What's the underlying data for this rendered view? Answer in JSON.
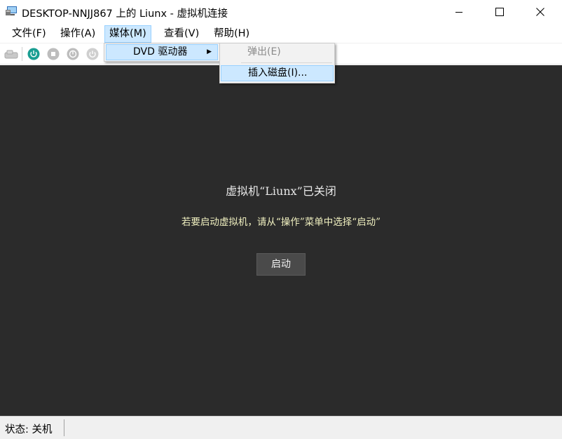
{
  "window": {
    "title": "DESKTOP-NNJJ867 上的 Liunx - 虚拟机连接"
  },
  "menubar": {
    "items": [
      {
        "label": "文件(F)"
      },
      {
        "label": "操作(A)"
      },
      {
        "label": "媒体(M)"
      },
      {
        "label": "查看(V)"
      },
      {
        "label": "帮助(H)"
      }
    ]
  },
  "media_menu": {
    "dvd_drive": "DVD 驱动器"
  },
  "dvd_submenu": {
    "eject": "弹出(E)",
    "insert_disk": "插入磁盘(I)..."
  },
  "main": {
    "status_title": "虚拟机“Liunx”已关闭",
    "hint": "若要启动虚拟机，请从“操作”菜单中选择“启动”",
    "start_button": "启动"
  },
  "statusbar": {
    "text": "状态: 关机"
  },
  "colors": {
    "vm_background": "#2b2b2b",
    "highlight": "#cce8ff",
    "power_icon": "#1a9e92"
  }
}
